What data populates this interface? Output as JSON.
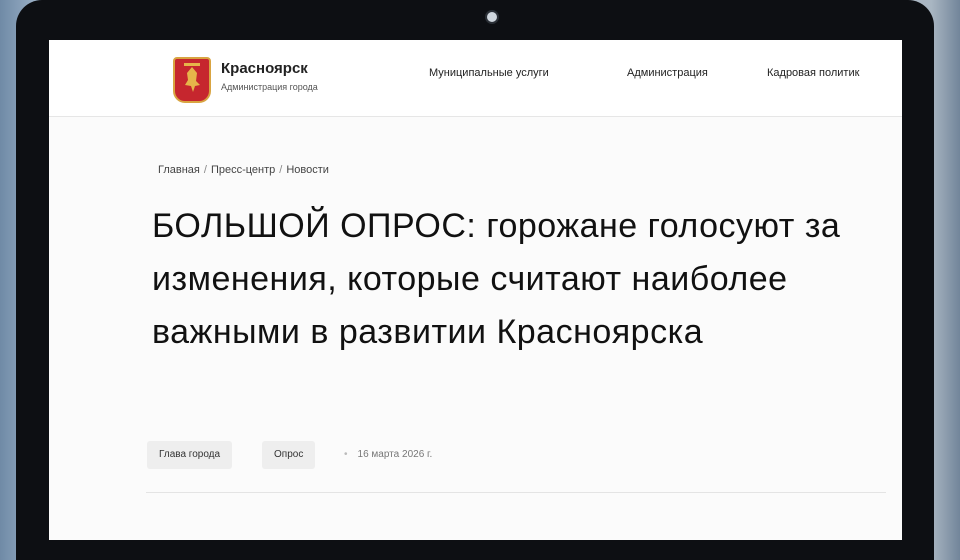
{
  "site": {
    "name": "Красноярск",
    "subtitle": "Администрация города"
  },
  "nav": {
    "items": [
      {
        "label": "Муниципальные услуги"
      },
      {
        "label": "Администрация"
      },
      {
        "label": "Кадровая политик"
      }
    ]
  },
  "breadcrumb": {
    "items": [
      "Главная",
      "Пресс-центр",
      "Новости"
    ],
    "separator": "/"
  },
  "article": {
    "title": "БОЛЬШОЙ ОПРОС: горожане голосуют за изменения, которые считают наиболее важными в развитии Красноярска",
    "tags": [
      "Глава города",
      "Опрос"
    ],
    "date": "16 марта 2026 г."
  },
  "colors": {
    "brand_red": "#c6262e",
    "emblem_gold": "#d9a441"
  }
}
